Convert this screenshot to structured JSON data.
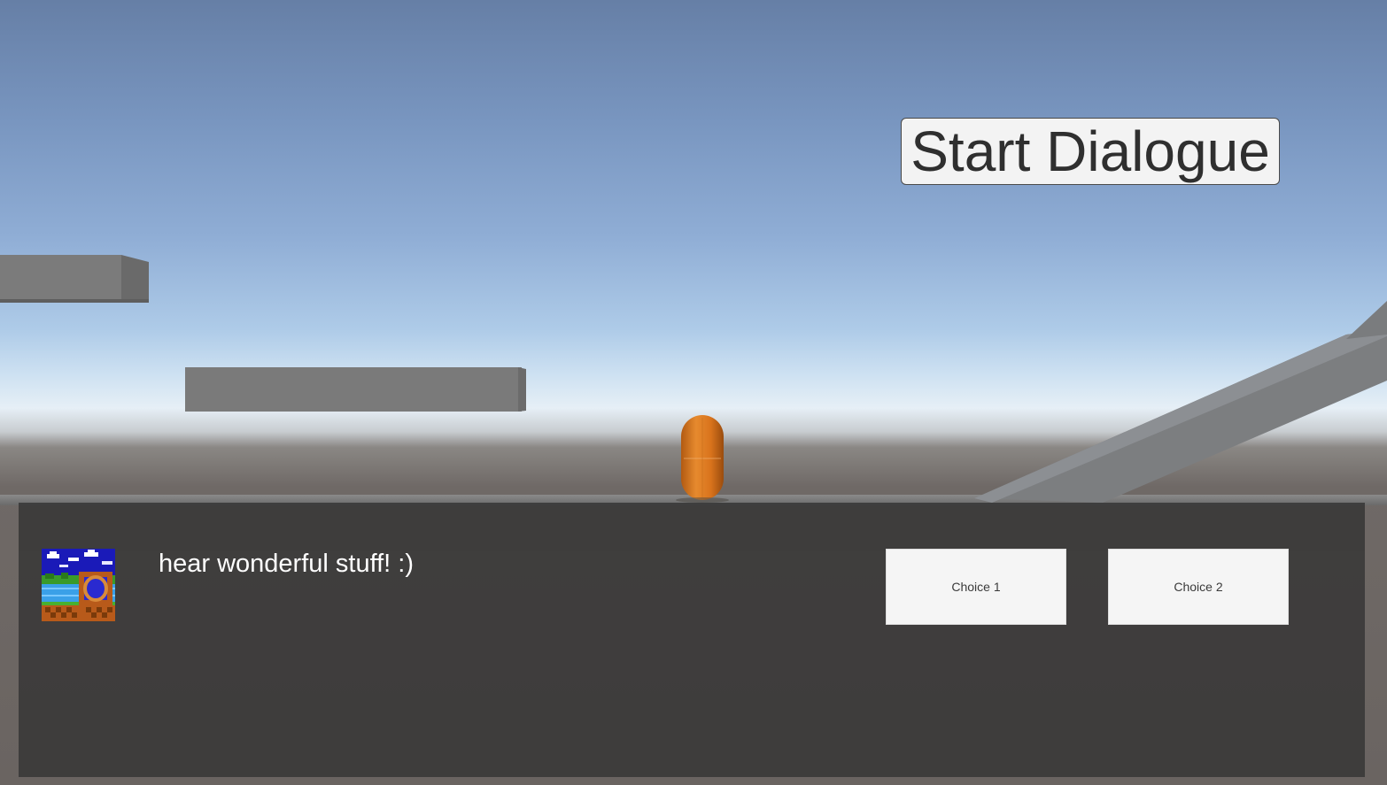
{
  "hud": {
    "start_dialogue_label": "Start Dialogue"
  },
  "dialogue": {
    "text": "hear wonderful stuff! :)",
    "portrait_icon": "landscape-portrait-icon",
    "choices": [
      {
        "label": "Choice 1"
      },
      {
        "label": "Choice 2"
      }
    ]
  },
  "colors": {
    "player": "#d9731c",
    "platform": "#7a7a7a",
    "panel": "#3a3a3a"
  }
}
